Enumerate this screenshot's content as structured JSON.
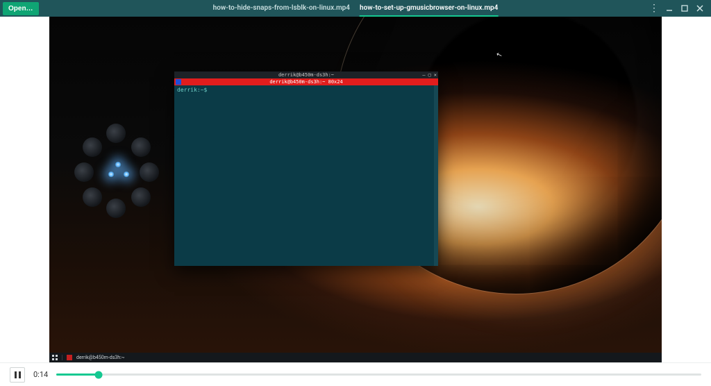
{
  "header": {
    "open_label": "Open…",
    "tabs": [
      {
        "label": "how-to-hide-snaps-from-lsblk-on-linux.mp4",
        "active": false
      },
      {
        "label": "how-to-set-up-gmusicbrowser-on-linux.mp4",
        "active": true
      }
    ]
  },
  "terminal": {
    "title": "derrik@b450m-ds3h:~",
    "redbar": "derrik@b450m-ds3h:~ 80x24",
    "prompt": "derrik:~$"
  },
  "taskbar": {
    "entry": "derrik@b450m-ds3h:~"
  },
  "player": {
    "time": "0:14",
    "progress_pct": 6.5
  },
  "colors": {
    "accent": "#15c891",
    "header_bg": "#20555a",
    "open_btn": "#0fa574",
    "term_bg": "#0b3b47",
    "term_red": "#e11d1d"
  }
}
